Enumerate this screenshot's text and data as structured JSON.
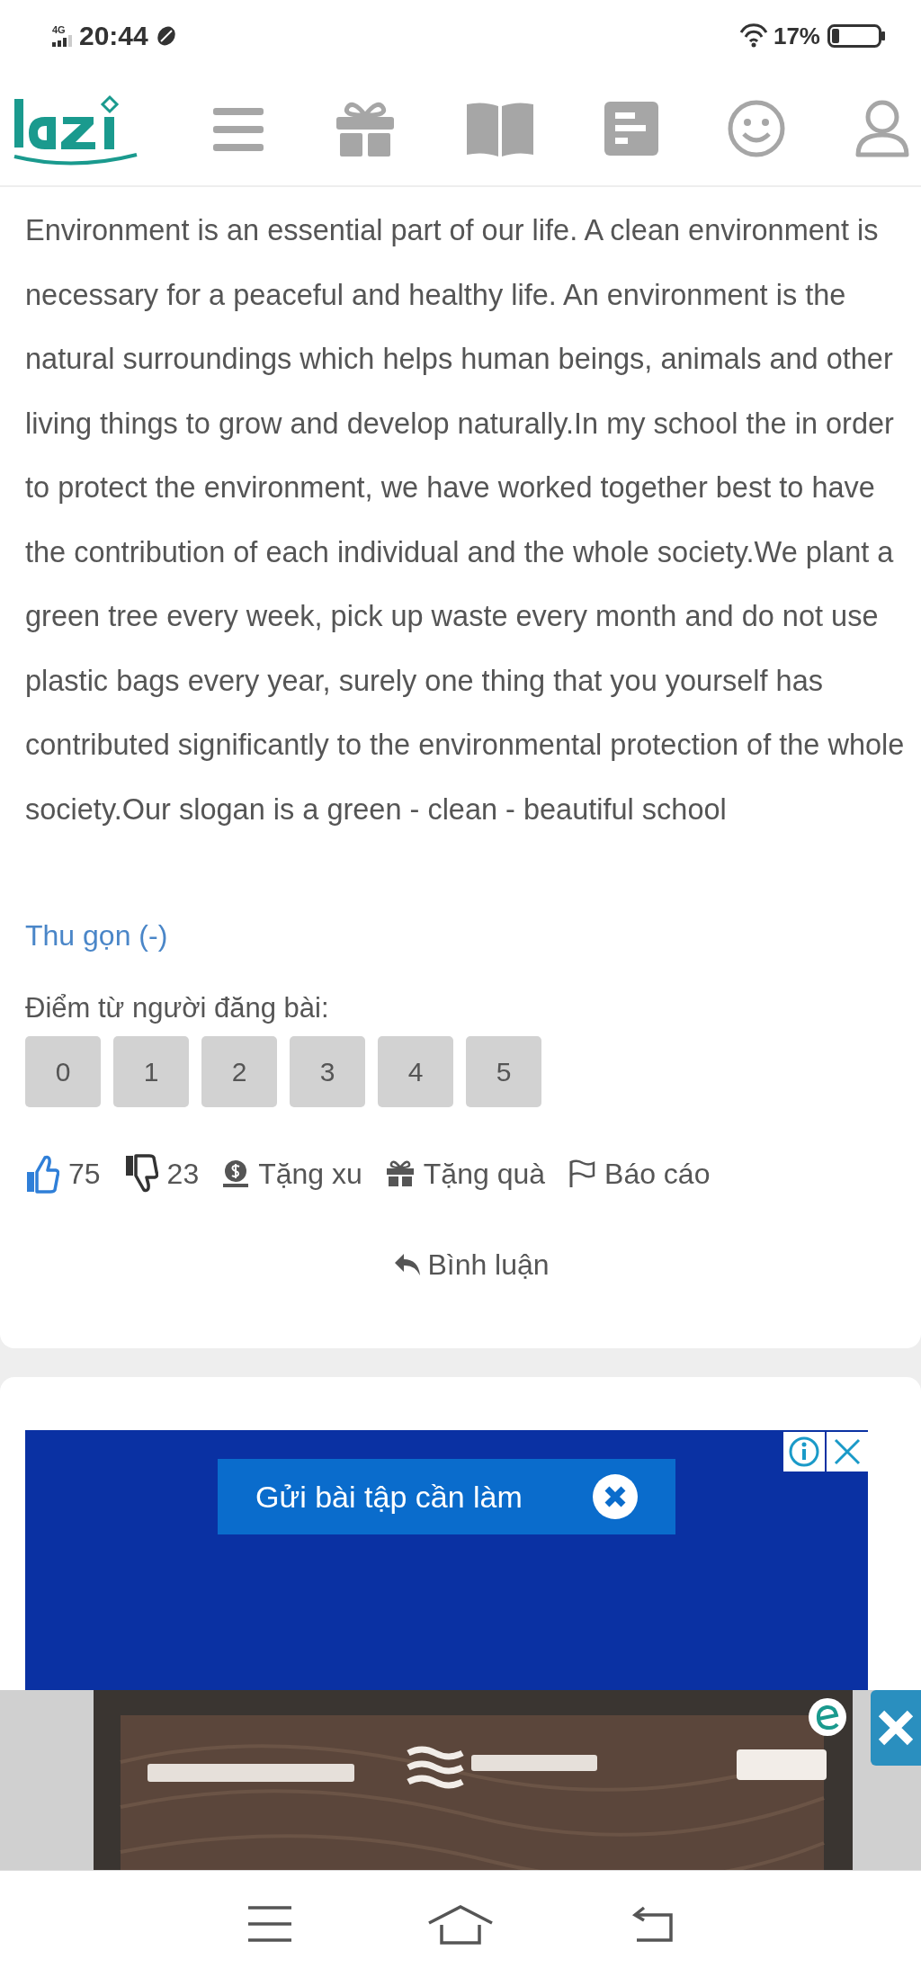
{
  "status_bar": {
    "network": "4G",
    "time": "20:44",
    "battery": "17%"
  },
  "answer": {
    "paragraph": "Environment is an essential part of our life. A clean environment is necessary for a peaceful and healthy life. An environment is the natural surroundings which helps human beings, animals and other living things to grow and develop naturally.In my school the in order to protect the environment, we have worked together best to have the contribution of each individual and the whole society.We plant a green tree every week, pick up waste every month and do not use plastic bags every year, surely one thing that you yourself has contributed significantly to the environmental protection of the whole society.Our slogan is a green - clean - beautiful school",
    "collapse_link": "Thu gọn (-)"
  },
  "rating": {
    "label": "Điểm từ người đăng bài:",
    "scores": [
      {
        "label": "0",
        "selected": false
      },
      {
        "label": "1",
        "selected": false
      },
      {
        "label": "2",
        "selected": false
      },
      {
        "label": "3",
        "selected": false
      },
      {
        "label": "4",
        "selected": false
      },
      {
        "label": "5",
        "selected": false
      }
    ]
  },
  "actions": [
    {
      "kind": "like",
      "label": "75"
    },
    {
      "kind": "dislike",
      "label": "23"
    },
    {
      "kind": "coin",
      "label": "Tặng xu"
    },
    {
      "kind": "gift",
      "label": "Tặng quà"
    },
    {
      "kind": "flag",
      "label": "Báo cáo"
    }
  ],
  "comment": {
    "label": "Bình luận"
  },
  "ad": {
    "button": "Gửi bài tập cần làm"
  }
}
